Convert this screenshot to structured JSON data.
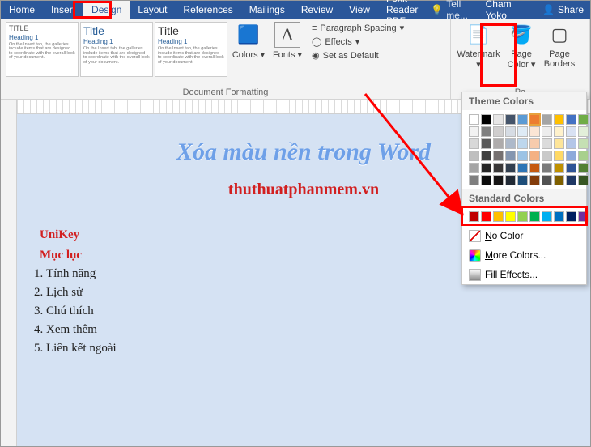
{
  "tabs": [
    "Home",
    "Insert",
    "Design",
    "Layout",
    "References",
    "Mailings",
    "Review",
    "View",
    "Foxit Reader PDF"
  ],
  "active_tab": "Design",
  "tellme": "Tell me...",
  "user": "Cham Yoko",
  "share": "Share",
  "ribbon": {
    "doc_formatting_label": "Document Formatting",
    "colors": "Colors",
    "fonts": "Fonts",
    "para_spacing": "Paragraph Spacing",
    "effects": "Effects",
    "set_default": "Set as Default",
    "page_bg_label": "Pa",
    "watermark": "Watermark",
    "page_color": "Page Color",
    "page_borders": "Page Borders",
    "fmt_title_small": "TITLE",
    "fmt_title_big": "Title",
    "fmt_heading": "Heading 1",
    "fmt_lorem": "On the Insert tab, the galleries include items that are designed to coordinate with the overall look of your document."
  },
  "dropdown": {
    "theme": "Theme Colors",
    "standard": "Standard Colors",
    "no_color": "No Color",
    "more": "More Colors...",
    "fill": "Fill Effects...",
    "theme_rows": [
      [
        "#ffffff",
        "#000000",
        "#e7e6e6",
        "#44546a",
        "#5b9bd5",
        "#ed7d31",
        "#a5a5a5",
        "#ffc000",
        "#4472c4",
        "#70ad47"
      ],
      [
        "#f2f2f2",
        "#7f7f7f",
        "#d0cece",
        "#d6dce4",
        "#deebf6",
        "#fbe5d5",
        "#ededed",
        "#fff2cc",
        "#d9e2f3",
        "#e2efd9"
      ],
      [
        "#d8d8d8",
        "#595959",
        "#aeabab",
        "#adb9ca",
        "#bdd7ee",
        "#f7cbac",
        "#dbdbdb",
        "#fee599",
        "#b4c6e7",
        "#c5e0b3"
      ],
      [
        "#bfbfbf",
        "#3f3f3f",
        "#757070",
        "#8496b0",
        "#9cc3e5",
        "#f4b183",
        "#c9c9c9",
        "#ffd965",
        "#8eaadb",
        "#a8d08d"
      ],
      [
        "#a5a5a5",
        "#262626",
        "#3a3838",
        "#323f4f",
        "#2e75b5",
        "#c55a11",
        "#7b7b7b",
        "#bf9000",
        "#2f5496",
        "#538135"
      ],
      [
        "#7f7f7f",
        "#0c0c0c",
        "#171616",
        "#222a35",
        "#1e4e79",
        "#833c0b",
        "#525252",
        "#7f6000",
        "#1f3864",
        "#375623"
      ]
    ],
    "standard_row": [
      "#c00000",
      "#ff0000",
      "#ffc000",
      "#ffff00",
      "#92d050",
      "#00b050",
      "#00b0f0",
      "#0070c0",
      "#002060",
      "#7030a0"
    ],
    "selected_theme": [
      0,
      5
    ]
  },
  "document": {
    "title": "Xóa màu nền trong Word",
    "url": "thuthuatphanmem.vn",
    "section": "UniKey",
    "toc_label": "Mục lục",
    "toc": [
      "Tính năng",
      "Lịch sử",
      "Chú thích",
      "Xem thêm",
      "Liên kết ngoài"
    ]
  }
}
